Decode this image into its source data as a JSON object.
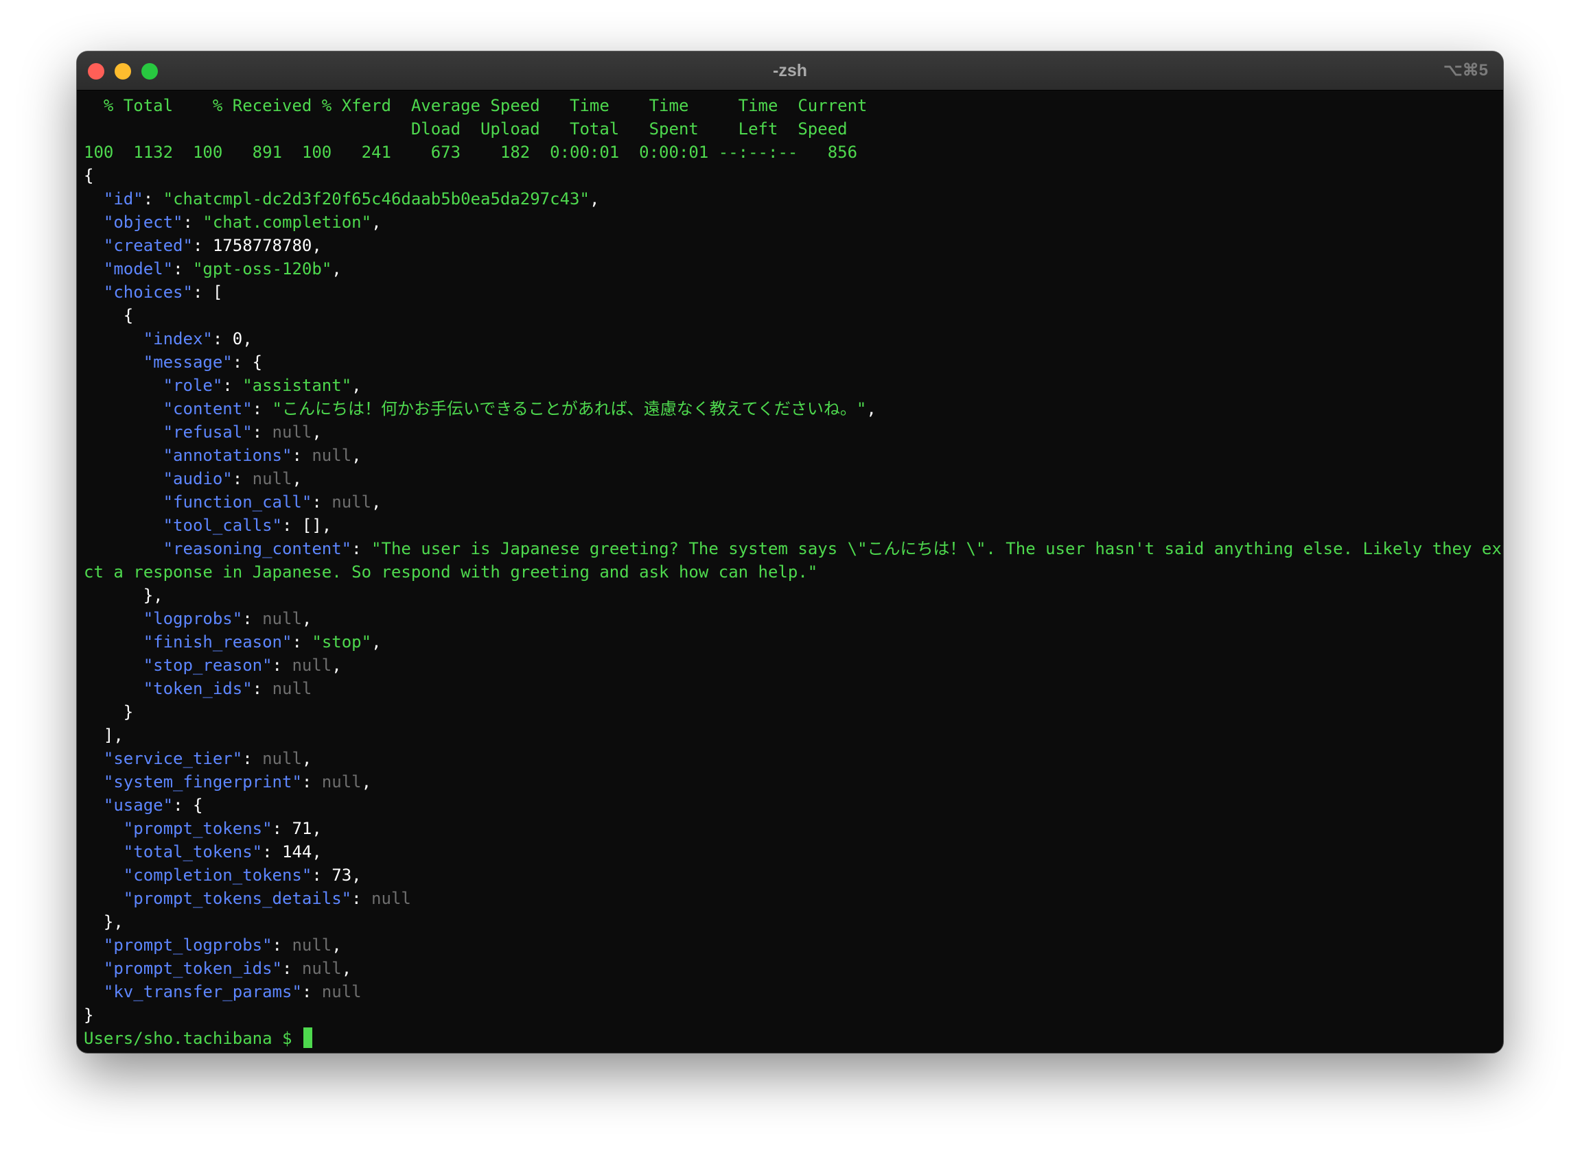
{
  "window": {
    "title": "-zsh",
    "shortcut": "⌥⌘5"
  },
  "curl_progress": {
    "header1": "  % Total    % Received % Xferd  Average Speed   Time    Time     Time  Current",
    "header2": "                                 Dload  Upload   Total   Spent    Left  Speed",
    "row": "100  1132  100   891  100   241    673    182  0:00:01  0:00:01 --:--:--   856"
  },
  "json": {
    "id": "chatcmpl-dc2d3f20f65c46daab5b0ea5da297c43",
    "object": "chat.completion",
    "created": "1758778780",
    "model": "gpt-oss-120b",
    "choice": {
      "index": "0",
      "role": "assistant",
      "content": "こんにちは！何かお手伝いできることがあれば、遠慮なく教えてくださいね。",
      "reasoning_line1": "The user is Japanese greeting? The system says \\\"こんにちは！\\\". The user hasn't said anything else. Likely they expe",
      "reasoning_line2": "ct a response in Japanese. So respond with greeting and ask how can help.",
      "finish_reason": "stop"
    },
    "usage": {
      "prompt_tokens": "71",
      "total_tokens": "144",
      "completion_tokens": "73"
    },
    "null_literal": "null",
    "empty_array": "[]"
  },
  "prompt": {
    "path": "Users/sho.tachibana $"
  },
  "colors": {
    "green": "#4ed94e",
    "blue_key": "#5d86ff",
    "null_gray": "#6e6e6e",
    "background": "#0c0c0c"
  }
}
